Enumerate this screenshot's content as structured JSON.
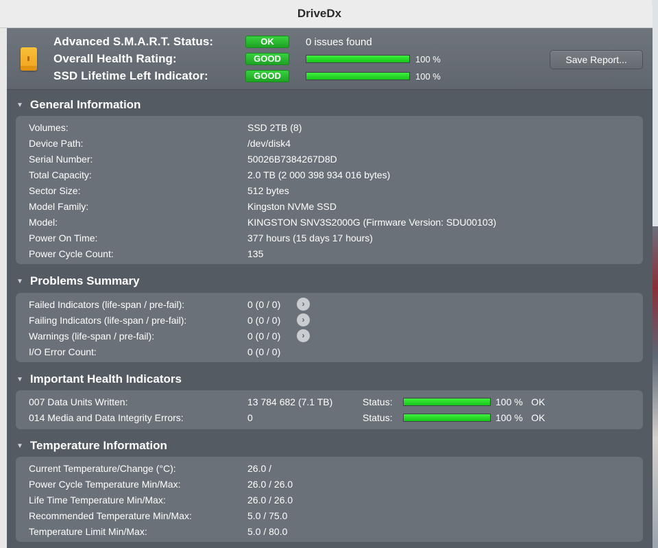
{
  "window": {
    "title": "DriveDx"
  },
  "header": {
    "smart_status": {
      "label": "Advanced S.M.A.R.T. Status:",
      "badge": "OK",
      "text": "0 issues found"
    },
    "health_rating": {
      "label": "Overall Health Rating:",
      "badge": "GOOD",
      "percent_text": "100 %",
      "percent": 100
    },
    "lifetime_left": {
      "label": "SSD Lifetime Left Indicator:",
      "badge": "GOOD",
      "percent_text": "100 %",
      "percent": 100
    },
    "save_button": "Save Report...",
    "icon": "drive-icon"
  },
  "general": {
    "title": "General Information",
    "rows": [
      {
        "label": "Volumes:",
        "value": "SSD 2TB (8)"
      },
      {
        "label": "Device Path:",
        "value": "/dev/disk4"
      },
      {
        "label": "Serial Number:",
        "value": "50026B7384267D8D"
      },
      {
        "label": "Total Capacity:",
        "value": "2.0 TB (2 000 398 934 016 bytes)"
      },
      {
        "label": "Sector Size:",
        "value": "512 bytes"
      },
      {
        "label": "Model Family:",
        "value": "Kingston NVMe SSD"
      },
      {
        "label": "Model:",
        "value": "KINGSTON SNV3S2000G  (Firmware Version: SDU00103)"
      },
      {
        "label": "Power On Time:",
        "value": "377 hours (15 days 17 hours)"
      },
      {
        "label": "Power Cycle Count:",
        "value": "135"
      }
    ]
  },
  "problems": {
    "title": "Problems Summary",
    "rows": [
      {
        "label": "Failed Indicators (life-span / pre-fail):",
        "value": "0 (0 / 0)",
        "has_arrow": true
      },
      {
        "label": "Failing Indicators (life-span / pre-fail):",
        "value": "0 (0 / 0)",
        "has_arrow": true
      },
      {
        "label": "Warnings (life-span / pre-fail):",
        "value": "0 (0 / 0)",
        "has_arrow": true
      },
      {
        "label": "I/O Error Count:",
        "value": "0 (0 / 0)",
        "has_arrow": false
      }
    ]
  },
  "health": {
    "title": "Important Health Indicators",
    "rows": [
      {
        "label": "007  Data Units Written:",
        "value": "13 784 682 (7.1 TB)",
        "status_label": "Status:",
        "percent": 100,
        "percent_text": "100 %",
        "state": "OK"
      },
      {
        "label": "014  Media and Data Integrity Errors:",
        "value": "0",
        "status_label": "Status:",
        "percent": 100,
        "percent_text": "100 %",
        "state": "OK"
      }
    ]
  },
  "temperature": {
    "title": "Temperature Information",
    "rows": [
      {
        "label": "Current Temperature/Change (°C):",
        "value": "26.0 /"
      },
      {
        "label": "Power Cycle Temperature Min/Max:",
        "value": "26.0 / 26.0"
      },
      {
        "label": "Life Time Temperature Min/Max:",
        "value": "26.0 / 26.0"
      },
      {
        "label": "Recommended Temperature Min/Max:",
        "value": "5.0   / 75.0"
      },
      {
        "label": "Temperature Limit Min/Max:",
        "value": "5.0   / 80.0"
      }
    ]
  },
  "colors": {
    "accent_green": "#1ea224",
    "panel": "#6b7178",
    "background": "#555b62"
  }
}
